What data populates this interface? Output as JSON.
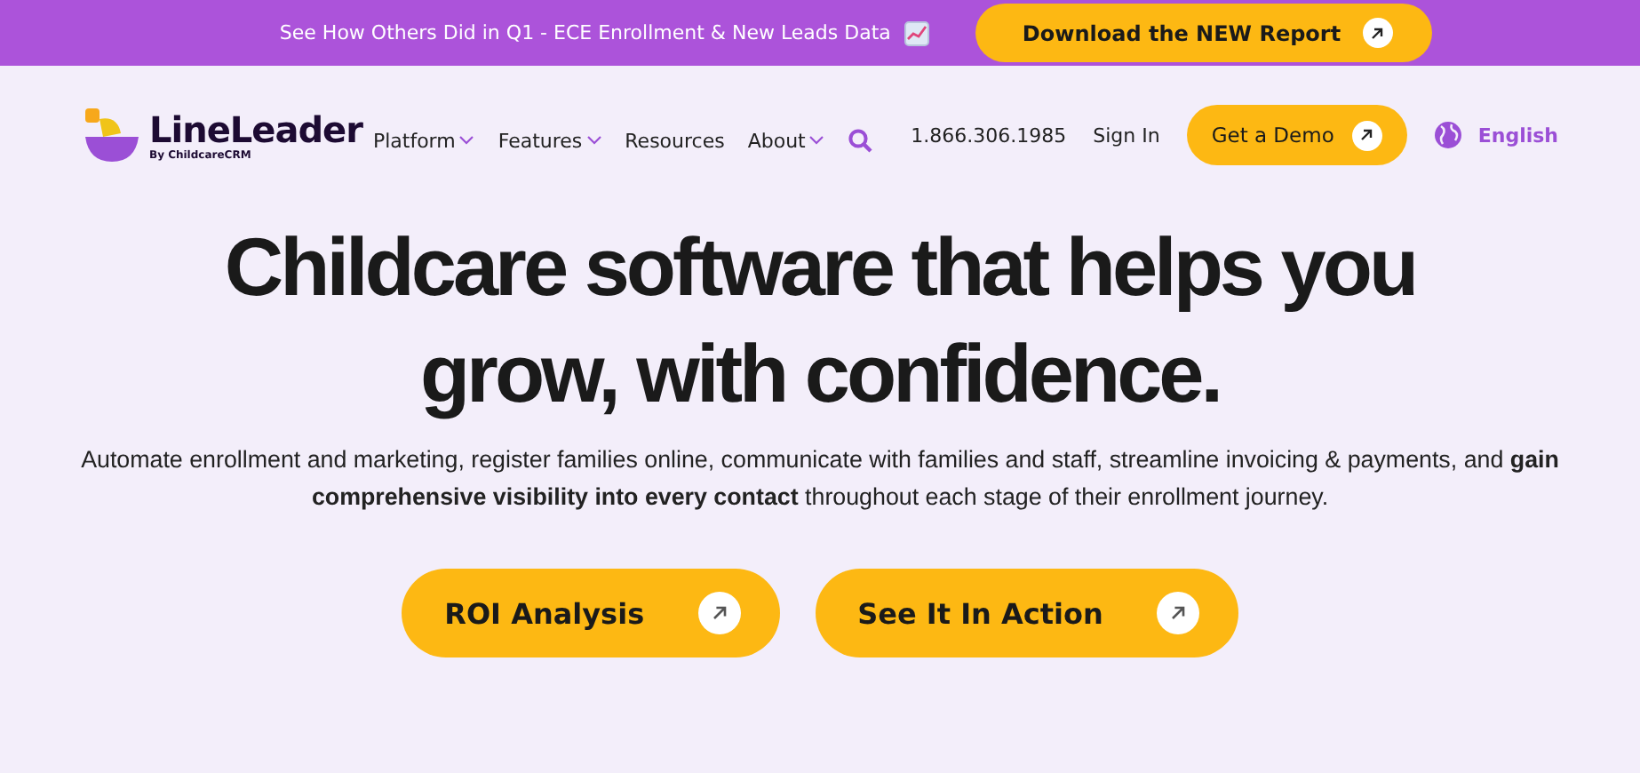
{
  "banner": {
    "text": "See How Others Did in Q1 - ECE Enrollment & New Leads Data",
    "button": "Download the NEW Report"
  },
  "logo": {
    "name": "LineLeader",
    "tagline": "By ChildcareCRM"
  },
  "nav": [
    {
      "label": "Platform",
      "has_menu": true
    },
    {
      "label": "Features",
      "has_menu": true
    },
    {
      "label": "Resources",
      "has_menu": false
    },
    {
      "label": "About",
      "has_menu": true
    }
  ],
  "phone": "1.866.306.1985",
  "sign_in": "Sign In",
  "demo_button": "Get a Demo",
  "language": "English",
  "hero": {
    "title_lines": [
      "Childcare software that helps you",
      "grow, with confidence."
    ],
    "description": "Automate enrollment and marketing, register families online, communicate with families and staff, streamline invoicing & payments, and **gain comprehensive visibility into every contact** throughout each stage of their enrollment journey.",
    "buttons": [
      "ROI Analysis",
      "See It In Action"
    ]
  }
}
